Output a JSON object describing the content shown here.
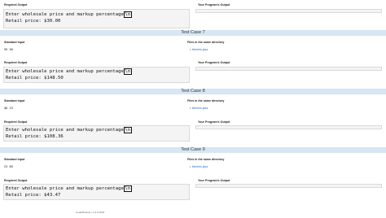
{
  "labels": {
    "required_output": "Required Output",
    "your_output": "Your Program's Output",
    "standard_input": "Standard Input",
    "files_in_dir": "Files in the same directory"
  },
  "top_case": {
    "output_line1": "Enter wholesale price and markup percentage",
    "cursor_glyph": "\\n",
    "output_line2": "Retail price: $30.00"
  },
  "cases": [
    {
      "title": "Test Case 7",
      "stdin": "95 50",
      "file": "ItemInfo.java",
      "output_line1": "Enter wholesale price and markup percentage",
      "cursor_glyph": "\\n",
      "output_line2": "Retail price: $148.50"
    },
    {
      "title": "Test Case 8",
      "stdin": "$6 23",
      "file": "ItemInfo.java",
      "output_line1": "Enter wholesale price and markup percentage",
      "cursor_glyph": "\\n",
      "output_line2": "Retail price: $108.36"
    },
    {
      "title": "Test Case 9",
      "stdin": "23 89",
      "file": "ItemInfo.java",
      "output_line1": "Enter wholesale price and markup percentage",
      "cursor_glyph": "\\n",
      "output_line2": "Retail price: $43.47"
    }
  ],
  "footer": "CodeWorkout • 1.0.0 2023",
  "colors": {
    "bar": "#d6e6f3",
    "link": "#2a6ebb",
    "box": "#f4f4f4"
  }
}
